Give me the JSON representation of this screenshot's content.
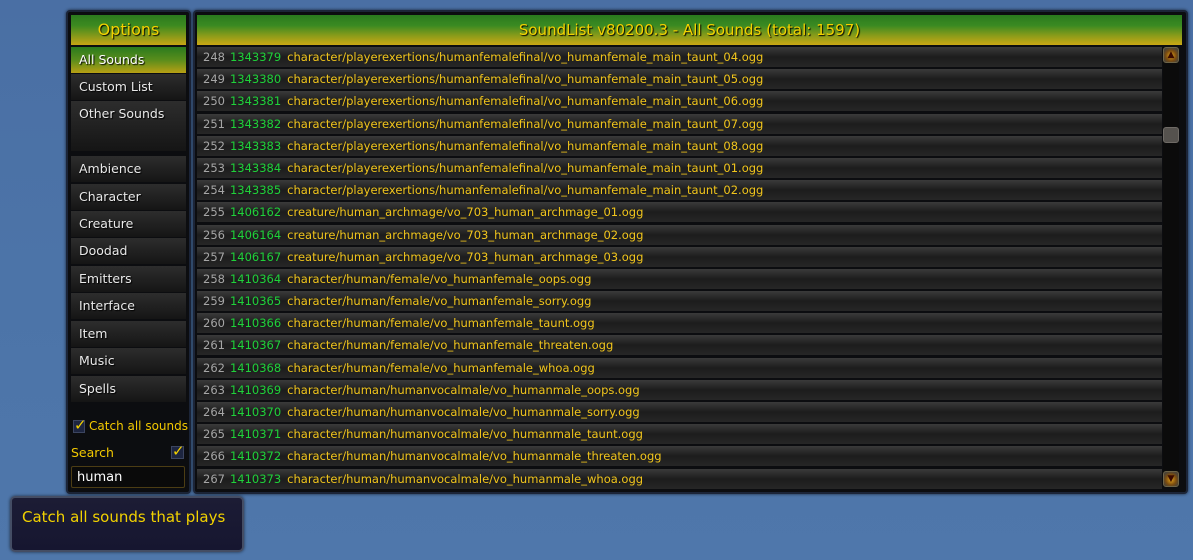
{
  "options_panel": {
    "title": "Options",
    "top_items": [
      {
        "label": "All Sounds",
        "active": true
      },
      {
        "label": "Custom List",
        "active": false
      },
      {
        "label": "Other Sounds",
        "active": false
      }
    ],
    "categories": [
      {
        "label": "Ambience"
      },
      {
        "label": "Character"
      },
      {
        "label": "Creature"
      },
      {
        "label": "Doodad"
      },
      {
        "label": "Emitters"
      },
      {
        "label": "Interface"
      },
      {
        "label": "Item"
      },
      {
        "label": "Music"
      },
      {
        "label": "Spells"
      }
    ],
    "catch_all": {
      "label": "Catch all sounds",
      "checked": true
    },
    "search": {
      "label": "Search",
      "checked": true,
      "value": "human"
    }
  },
  "sound_list": {
    "title": "SoundList v80200.3 - All Sounds (total: 1597)",
    "rows": [
      {
        "index": "248",
        "id": "1343379",
        "path": "character/playerexertions/humanfemalefinal/vo_humanfemale_main_taunt_04.ogg"
      },
      {
        "index": "249",
        "id": "1343380",
        "path": "character/playerexertions/humanfemalefinal/vo_humanfemale_main_taunt_05.ogg"
      },
      {
        "index": "250",
        "id": "1343381",
        "path": "character/playerexertions/humanfemalefinal/vo_humanfemale_main_taunt_06.ogg"
      },
      {
        "index": "251",
        "id": "1343382",
        "path": "character/playerexertions/humanfemalefinal/vo_humanfemale_main_taunt_07.ogg"
      },
      {
        "index": "252",
        "id": "1343383",
        "path": "character/playerexertions/humanfemalefinal/vo_humanfemale_main_taunt_08.ogg"
      },
      {
        "index": "253",
        "id": "1343384",
        "path": "character/playerexertions/humanfemalefinal/vo_humanfemale_main_taunt_01.ogg"
      },
      {
        "index": "254",
        "id": "1343385",
        "path": "character/playerexertions/humanfemalefinal/vo_humanfemale_main_taunt_02.ogg"
      },
      {
        "index": "255",
        "id": "1406162",
        "path": "creature/human_archmage/vo_703_human_archmage_01.ogg"
      },
      {
        "index": "256",
        "id": "1406164",
        "path": "creature/human_archmage/vo_703_human_archmage_02.ogg"
      },
      {
        "index": "257",
        "id": "1406167",
        "path": "creature/human_archmage/vo_703_human_archmage_03.ogg"
      },
      {
        "index": "258",
        "id": "1410364",
        "path": "character/human/female/vo_humanfemale_oops.ogg"
      },
      {
        "index": "259",
        "id": "1410365",
        "path": "character/human/female/vo_humanfemale_sorry.ogg"
      },
      {
        "index": "260",
        "id": "1410366",
        "path": "character/human/female/vo_humanfemale_taunt.ogg"
      },
      {
        "index": "261",
        "id": "1410367",
        "path": "character/human/female/vo_humanfemale_threaten.ogg"
      },
      {
        "index": "262",
        "id": "1410368",
        "path": "character/human/female/vo_humanfemale_whoa.ogg"
      },
      {
        "index": "263",
        "id": "1410369",
        "path": "character/human/humanvocalmale/vo_humanmale_oops.ogg"
      },
      {
        "index": "264",
        "id": "1410370",
        "path": "character/human/humanvocalmale/vo_humanmale_sorry.ogg"
      },
      {
        "index": "265",
        "id": "1410371",
        "path": "character/human/humanvocalmale/vo_humanmale_taunt.ogg"
      },
      {
        "index": "266",
        "id": "1410372",
        "path": "character/human/humanvocalmale/vo_humanmale_threaten.ogg"
      },
      {
        "index": "267",
        "id": "1410373",
        "path": "character/human/humanvocalmale/vo_humanmale_whoa.ogg"
      }
    ],
    "scrollbar": {
      "up_icon": "scroll-up-icon",
      "down_icon": "scroll-down-icon",
      "position_fraction": 0.17
    }
  },
  "tooltip": {
    "text": "Catch all sounds that plays"
  },
  "colors": {
    "background": "#4c74a8",
    "header_green": "#2a7a1e",
    "header_gold": "#cba814",
    "title_text": "#f2d200",
    "row_index": "#a6a6a6",
    "row_id": "#1fd23a",
    "row_path": "#f1c51c"
  }
}
